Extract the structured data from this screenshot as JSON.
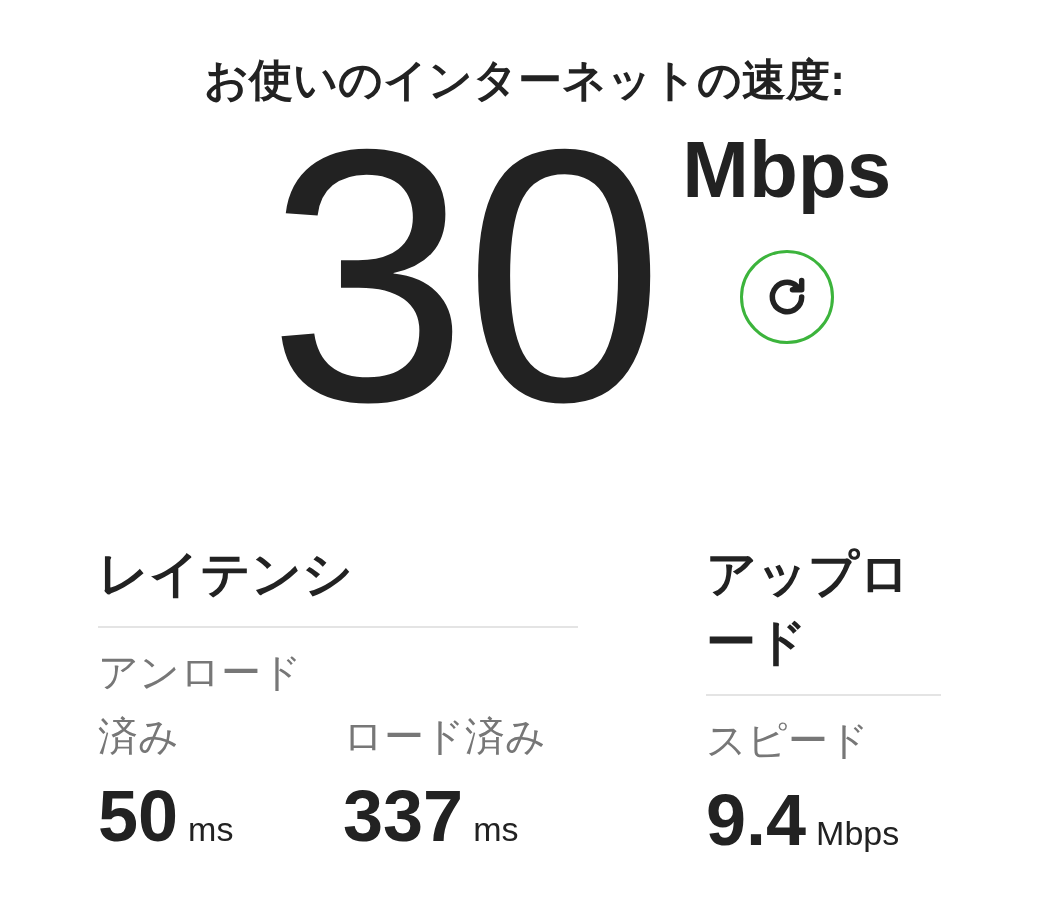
{
  "title": "お使いのインターネットの速度:",
  "speed": {
    "value": "30",
    "unit": "Mbps"
  },
  "sections": [
    {
      "heading": "レイテンシ",
      "metrics": [
        {
          "label": "アンロード済み",
          "value": "50",
          "unit": "ms"
        },
        {
          "label": "ロード済み",
          "value": "337",
          "unit": "ms"
        }
      ]
    },
    {
      "heading": "アップロード",
      "metrics": [
        {
          "label": "スピード",
          "value": "9.4",
          "unit": "Mbps"
        }
      ]
    }
  ]
}
